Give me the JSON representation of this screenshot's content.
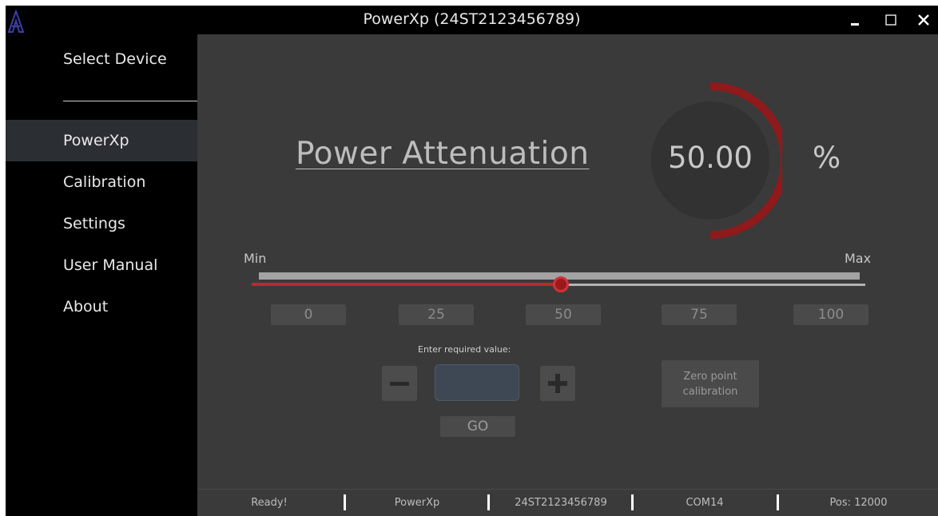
{
  "window": {
    "title": "PowerXp (24ST2123456789)",
    "controls": {
      "minimize": "_",
      "maximize": "☐",
      "close": "✕"
    }
  },
  "sidebar": {
    "select_device": "Select Device",
    "items": [
      {
        "label": "PowerXp",
        "active": true
      },
      {
        "label": "Calibration",
        "active": false
      },
      {
        "label": "Settings",
        "active": false
      },
      {
        "label": "User Manual",
        "active": false
      },
      {
        "label": "About",
        "active": false
      }
    ]
  },
  "main": {
    "heading": "Power Attenuation",
    "gauge": {
      "value": "50.00",
      "unit": "%",
      "fraction": 0.5
    },
    "slider": {
      "min_label": "Min",
      "max_label": "Max",
      "value": 50
    },
    "presets": [
      "0",
      "25",
      "50",
      "75",
      "100"
    ],
    "entry": {
      "label": "Enter required value:",
      "value": "",
      "go_label": "GO"
    },
    "zero_calibration": {
      "line1": "Zero point",
      "line2": "calibration"
    }
  },
  "statusbar": {
    "status": "Ready!",
    "device": "PowerXp",
    "serial": "24ST2123456789",
    "port": "COM14",
    "position": "Pos: 12000"
  },
  "colors": {
    "accent_red": "#c0282a",
    "background": "#3a3a3b",
    "sidebar": "#000000",
    "active_nav": "#2b2f33"
  }
}
